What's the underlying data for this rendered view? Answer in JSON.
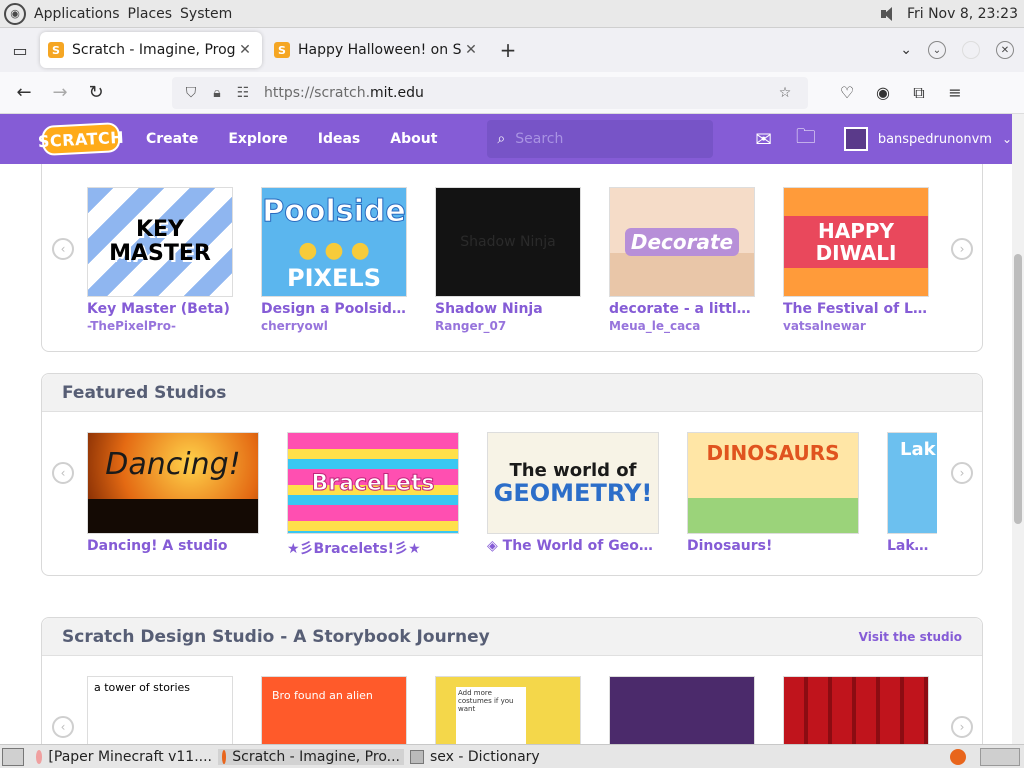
{
  "panel": {
    "menus": [
      "Applications",
      "Places",
      "System"
    ],
    "datetime": "Fri Nov 8, 23:23"
  },
  "browser": {
    "tabs": [
      {
        "title": "Scratch - Imagine, Progra",
        "active": true
      },
      {
        "title": "Happy Halloween! on Scr",
        "active": false
      }
    ],
    "url_prefix": "https://scratch.",
    "url_domain": "mit.edu"
  },
  "scratch": {
    "logo": "SCRATCH",
    "nav": [
      "Create",
      "Explore",
      "Ideas",
      "About"
    ],
    "search_placeholder": "Search",
    "username": "banspedrunonvm"
  },
  "projects_row": {
    "items": [
      {
        "title": "Key Master (Beta)",
        "author": "-ThePixelPro-",
        "art_text": "KEY MASTER"
      },
      {
        "title": "Design a Poolside...",
        "author": "cherryowl",
        "art_text": "Poolside",
        "art_text2": "PIXELS"
      },
      {
        "title": "Shadow Ninja",
        "author": "Ranger_07",
        "art_text": "Shadow Ninja"
      },
      {
        "title": "decorate - a little ...",
        "author": "Meua_le_caca",
        "art_text": "Decorate"
      },
      {
        "title": "The Festival of Li...",
        "author": "vatsalnewar",
        "art_text": "HAPPY DIWALI"
      }
    ]
  },
  "featured_studios": {
    "heading": "Featured Studios",
    "items": [
      {
        "title": "Dancing! A studio",
        "art_text": "Dancing!"
      },
      {
        "title": "★彡Bracelets!彡★",
        "art_text": "BraceLets"
      },
      {
        "title": "◈ The World of Geom...",
        "art_text": "The world of",
        "art_text2": "GEOMETRY!"
      },
      {
        "title": "Dinosaurs!",
        "art_text": "DINOSAURS"
      },
      {
        "title": "Lakes!",
        "art_text": "Lak"
      }
    ]
  },
  "design_studio": {
    "heading": "Scratch Design Studio - A Storybook Journey",
    "link": "Visit the studio",
    "items": [
      {
        "art_text": "a tower of stories"
      },
      {
        "art_text": "Bro found an alien"
      },
      {
        "art_text": "Add more costumes if you want"
      },
      {
        "art_text": ""
      },
      {
        "art_text": ""
      }
    ]
  },
  "taskbar": {
    "items": [
      "[Paper Minecraft v11....",
      "Scratch - Imagine, Pro...",
      "sex - Dictionary"
    ]
  },
  "colors": {
    "scratch_purple": "#855cd6",
    "scratch_orange": "#ffab19",
    "heading_gray": "#575e75"
  }
}
